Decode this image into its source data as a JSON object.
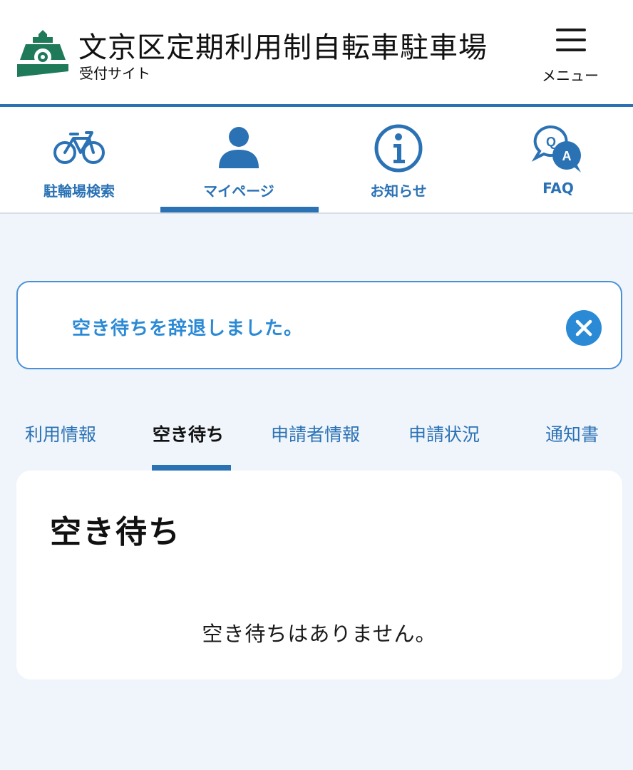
{
  "header": {
    "title": "文京区定期利用制自転車駐車場",
    "subtitle": "受付サイト",
    "menu_label": "メニュー",
    "logo_color": "#1f7a5a"
  },
  "nav": {
    "items": [
      {
        "label": "駐輪場検索",
        "icon": "bicycle-icon"
      },
      {
        "label": "マイページ",
        "icon": "user-icon",
        "active": true
      },
      {
        "label": "お知らせ",
        "icon": "info-icon"
      },
      {
        "label": "FAQ",
        "icon": "faq-icon"
      }
    ],
    "accent_color": "#2b72b5"
  },
  "alert": {
    "message": "空き待ちを辞退しました。"
  },
  "tabs": {
    "items": [
      {
        "label": "利用情報"
      },
      {
        "label": "空き待ち",
        "active": true
      },
      {
        "label": "申請者情報"
      },
      {
        "label": "申請状況"
      },
      {
        "label": "通知書"
      }
    ]
  },
  "card": {
    "title": "空き待ち",
    "empty_message": "空き待ちはありません。"
  }
}
